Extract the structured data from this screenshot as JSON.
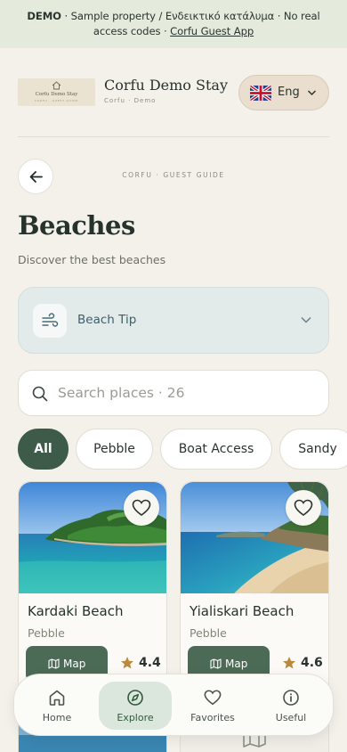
{
  "demo_banner": {
    "bold": "DEMO",
    "text": " · Sample property / Ενδεικτικό κατάλυμα · No real access codes · ",
    "link": "Corfu Guest App"
  },
  "header": {
    "logo_text": "Corfu Demo Stay",
    "logo_subtext": "CORFU · GUEST GUIDE",
    "brand_name": "Corfu Demo Stay",
    "brand_sub": "Corfu · Demo",
    "language": {
      "label": "Eng",
      "flag": "uk-flag-icon"
    }
  },
  "page": {
    "eyebrow": "CORFU · GUEST GUIDE",
    "title": "Beaches",
    "subtitle": "Discover the best beaches"
  },
  "tip": {
    "label": "Beach Tip",
    "icon": "wind-icon"
  },
  "search": {
    "placeholder": "Search places · 26",
    "value": ""
  },
  "filters": [
    {
      "label": "All",
      "active": true
    },
    {
      "label": "Pebble",
      "active": false
    },
    {
      "label": "Boat Access",
      "active": false
    },
    {
      "label": "Sandy",
      "active": false
    }
  ],
  "cards": [
    {
      "title": "Kardaki Beach",
      "type": "Pebble",
      "map_label": "Map",
      "rating": "4.4"
    },
    {
      "title": "Yialiskari Beach",
      "type": "Pebble",
      "map_label": "Map",
      "rating": "4.6"
    }
  ],
  "bottom_nav": [
    {
      "label": "Home",
      "icon": "home-icon",
      "active": false
    },
    {
      "label": "Explore",
      "icon": "compass-icon",
      "active": true
    },
    {
      "label": "Favorites",
      "icon": "heart-icon",
      "active": false
    },
    {
      "label": "Useful",
      "icon": "info-icon",
      "active": false
    }
  ],
  "colors": {
    "accent": "#3e5a48",
    "background": "#f3f1ea",
    "banner": "#e4eadc",
    "tip_card": "#e3eaea",
    "star": "#b98a3e"
  }
}
